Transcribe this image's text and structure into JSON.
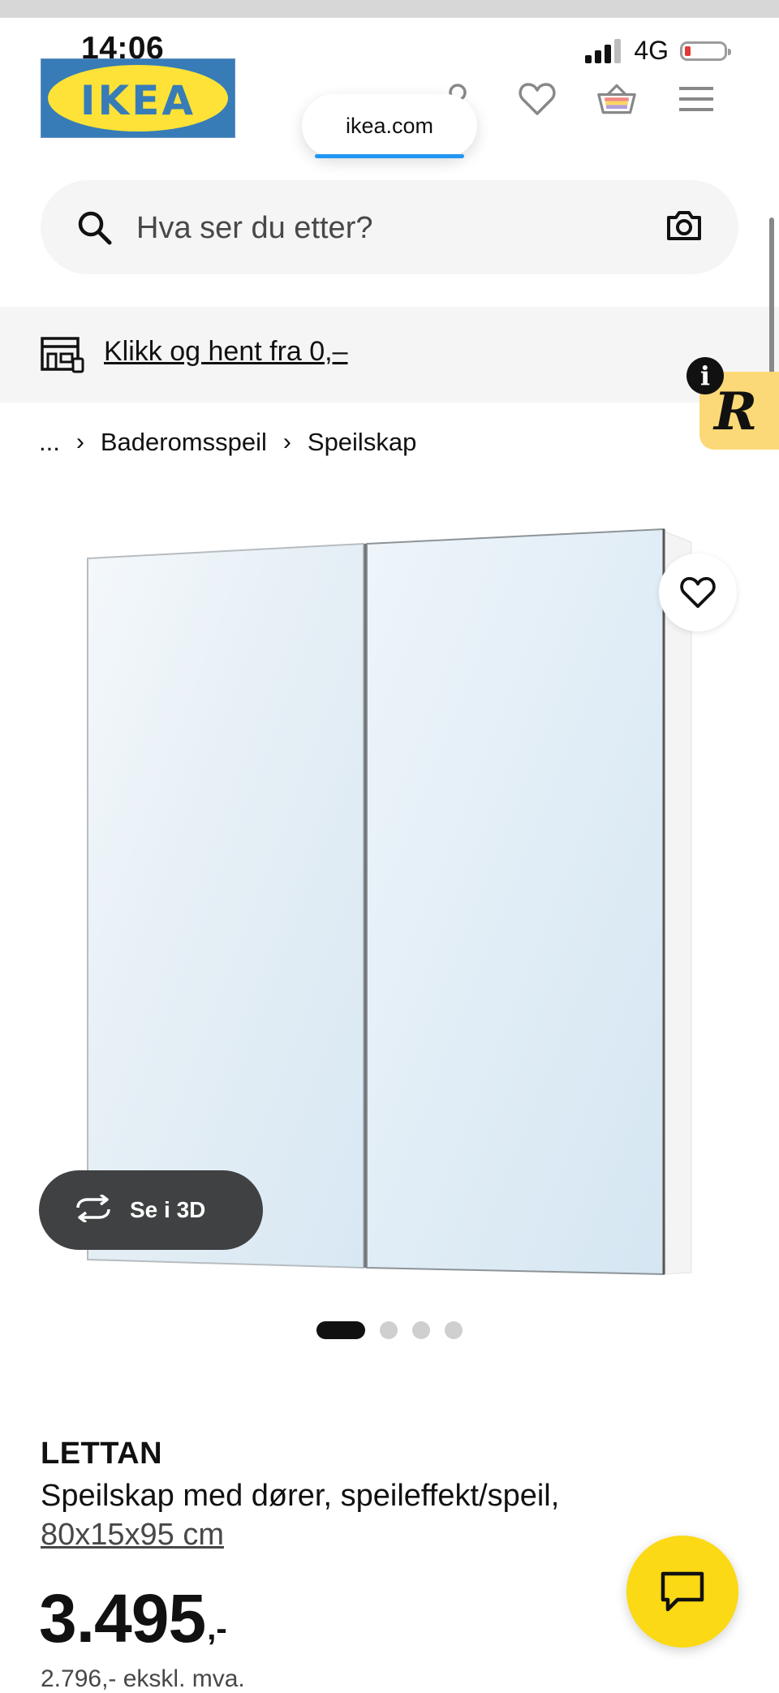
{
  "status_bar": {
    "time": "14:06",
    "network": "4G"
  },
  "header": {
    "logo_text": "IKEA",
    "url": "ikea.com"
  },
  "search": {
    "placeholder": "Hva ser du etter?"
  },
  "promo": {
    "link": "Klikk og hent fra 0,–"
  },
  "breadcrumb": {
    "ellipsis": "...",
    "items": [
      "Baderomsspeil",
      "Speilskap"
    ]
  },
  "gallery": {
    "view_3d_label": "Se i 3D",
    "page_count": 4,
    "active_page": 1
  },
  "product": {
    "name": "LETTAN",
    "description": "Speilskap med dører, speileffekt/speil,",
    "size": "80x15x95 cm",
    "price": "3.495",
    "price_suffix": ",-",
    "price_ex_vat": "2.796,- ekskl. mva."
  },
  "colors": {
    "ikea_blue": "#0058a3",
    "ikea_yellow": "#ffdb00",
    "chat_button": "#fbd914",
    "badge_yellow": "#fcd978",
    "accent_blue": "#2196f3"
  }
}
